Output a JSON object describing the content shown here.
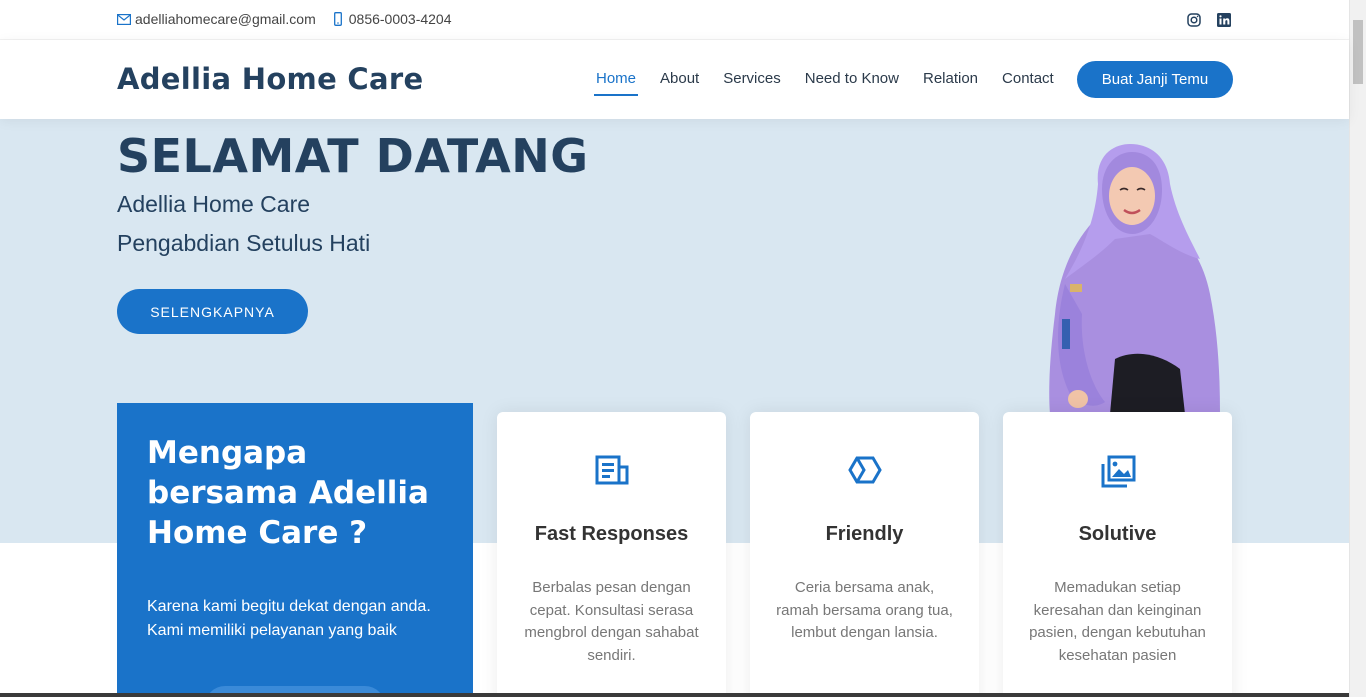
{
  "topbar": {
    "email": "adelliahomecare@gmail.com",
    "phone": "0856-0003-4204",
    "social": [
      "instagram-icon",
      "linkedin-icon"
    ]
  },
  "header": {
    "logo": "Adellia Home Care",
    "nav": [
      "Home",
      "About",
      "Services",
      "Need to Know",
      "Relation",
      "Contact"
    ],
    "active_nav": "Home",
    "cta": "Buat Janji Temu"
  },
  "hero": {
    "title": "SELAMAT DATANG",
    "line1": "Adellia Home Care",
    "line2": "Pengabdian Setulus Hati",
    "button": "SELENGKAPNYA"
  },
  "why": {
    "title": "Mengapa bersama Adellia Home Care ?",
    "text": "Karena kami begitu dekat dengan anda. Kami memiliki pelayanan yang baik"
  },
  "cards": [
    {
      "icon": "newspaper-icon",
      "title": "Fast Responses",
      "text": "Berbalas pesan dengan cepat. Konsultasi serasa mengbrol dengan sahabat sendiri."
    },
    {
      "icon": "hexagon-icon",
      "title": "Friendly",
      "text": "Ceria bersama anak, ramah bersama orang tua, lembut dengan lansia."
    },
    {
      "icon": "images-icon",
      "title": "Solutive",
      "text": "Memadukan setiap keresahan dan keinginan pasien, dengan kebutuhan kesehatan pasien"
    }
  ],
  "colors": {
    "accent": "#1a73c9",
    "heading": "#24415f",
    "hero_bg": "#d9e7f1"
  }
}
